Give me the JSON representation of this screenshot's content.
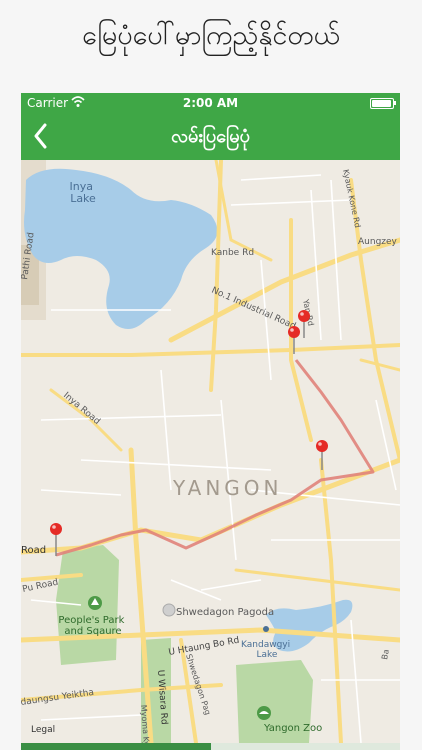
{
  "caption": "မြေပုံပေါ်မှာကြည့်နိုင်တယ်",
  "status_bar": {
    "carrier": "Carrier",
    "time": "2:00 AM"
  },
  "nav": {
    "title": "လမ်းပြမြေပုံ",
    "back_icon": "chevron-left-icon"
  },
  "colors": {
    "accent": "#3fa746",
    "route": "#e0837a",
    "pin": "#e52b26",
    "water": "#a7cce8",
    "park": "#b9d8a5",
    "road": "#f9dc84"
  },
  "map": {
    "city_label": "YANGON",
    "labels": {
      "inya_lake": "Inya\nLake",
      "kanbe": "Kanbe Rd",
      "industrial": "No.1 Industrial Road",
      "aungzey": "Aungzey",
      "kyauk_kone": "Kyauk Kone Rd",
      "mingalar": "Yan Rd",
      "inya_road": "Inya Road",
      "tapari": "Pathi Road",
      "road_left": "Road",
      "pu_road": "Pu Road",
      "peoples_park": "People's Park\nand Sqaure",
      "shwedagon": "Shwedagon Pagoda",
      "u_htaung_bo": "U Htaung Bo Rd",
      "kandawgyi": "Kandawgyi\nLake",
      "shwedagon_rd": "Shwedagon Pag",
      "yangon_zoo": "Yangon Zoo",
      "dagaung": "daungsu Yeiktha",
      "u_wisara": "U Wisara Rd",
      "myoma": "Myoma Ky",
      "legal": "Legal",
      "bo": "Ba"
    },
    "pins": [
      "pin-1",
      "pin-2",
      "pin-3",
      "pin-4"
    ]
  }
}
